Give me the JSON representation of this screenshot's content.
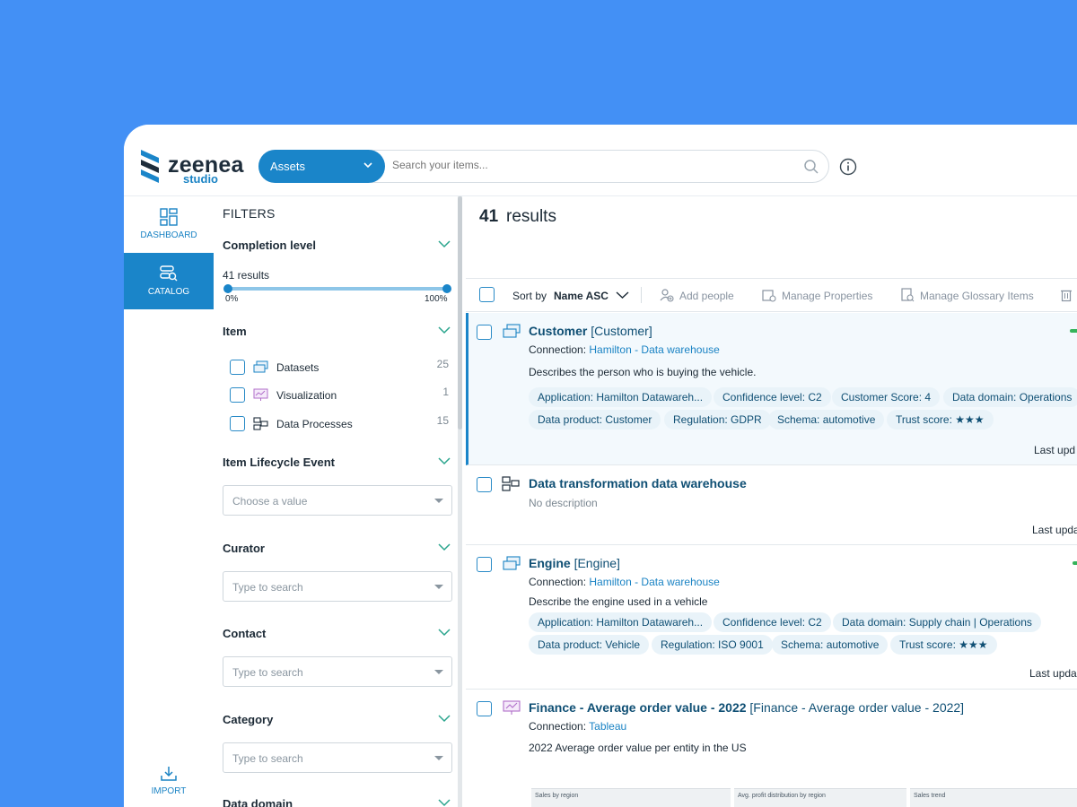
{
  "app": {
    "brand": "zeenea",
    "brand_sub": "studio"
  },
  "search": {
    "scope": "Assets",
    "placeholder": "Search your items..."
  },
  "nav": {
    "dashboard": "DASHBOARD",
    "catalog": "CATALOG",
    "import": "IMPORT"
  },
  "filters": {
    "title": "FILTERS",
    "completion": {
      "label": "Completion level",
      "results": "41 results",
      "min_label": "0%",
      "max_label": "100%",
      "range": [
        0,
        100
      ]
    },
    "item": {
      "label": "Item",
      "options": [
        {
          "label": "Datasets",
          "count": "25",
          "icon": "dataset-icon"
        },
        {
          "label": "Visualization",
          "count": "1",
          "icon": "visualization-icon"
        },
        {
          "label": "Data Processes",
          "count": "15",
          "icon": "data-process-icon"
        }
      ]
    },
    "lifecycle": {
      "label": "Item Lifecycle Event",
      "placeholder": "Choose a value"
    },
    "curator": {
      "label": "Curator",
      "placeholder": "Type to search"
    },
    "contact": {
      "label": "Contact",
      "placeholder": "Type to search"
    },
    "category": {
      "label": "Category",
      "placeholder": "Type to search"
    },
    "data_domain": {
      "label": "Data domain"
    }
  },
  "results": {
    "count": "41",
    "word": "results"
  },
  "toolbar": {
    "sort_by": "Sort by",
    "sort_value": "Name ASC",
    "add_people": "Add people",
    "manage_properties": "Manage Properties",
    "manage_glossary": "Manage Glossary Items"
  },
  "cards": [
    {
      "name": "Customer",
      "code": "[Customer]",
      "connection_label": "Connection:",
      "connection": "Hamilton - Data warehouse",
      "description": "Describes the person who is buying the vehicle.",
      "tags": [
        "Application: Hamilton Datawareh...",
        "Confidence level: C2",
        "Customer Score: 4",
        "Data domain: Operations",
        "Data product: Customer",
        "Regulation: GDPR",
        "Schema: automotive",
        "Trust score: ★★★"
      ],
      "last_updated": "Last upd"
    },
    {
      "name": "Data transformation data warehouse",
      "description": "No description",
      "last_updated": "Last upda"
    },
    {
      "name": "Engine",
      "code": "[Engine]",
      "connection_label": "Connection:",
      "connection": "Hamilton - Data warehouse",
      "description": "Describe the engine used in a vehicle",
      "tags": [
        "Application: Hamilton Datawareh...",
        "Confidence level: C2",
        "Data domain: Supply chain  | Operations",
        "Data product: Vehicle",
        "Regulation: ISO 9001",
        "Schema: automotive",
        "Trust score: ★★★"
      ],
      "last_updated": "Last upda"
    },
    {
      "name": "Finance - Average order value - 2022",
      "code": "[Finance - Average order value - 2022]",
      "connection_label": "Connection:",
      "connection": "Tableau",
      "description": "2022 Average order value per entity in the US",
      "preview_panels": [
        "Sales by region",
        "Avg. profit distribution by region",
        "Sales trend"
      ]
    }
  ],
  "colors": {
    "background": "#4390f5",
    "accent": "#1a85c9",
    "title": "#0f4f74",
    "tag_bg": "#e9f3f9",
    "status_green": "#35b35a"
  }
}
